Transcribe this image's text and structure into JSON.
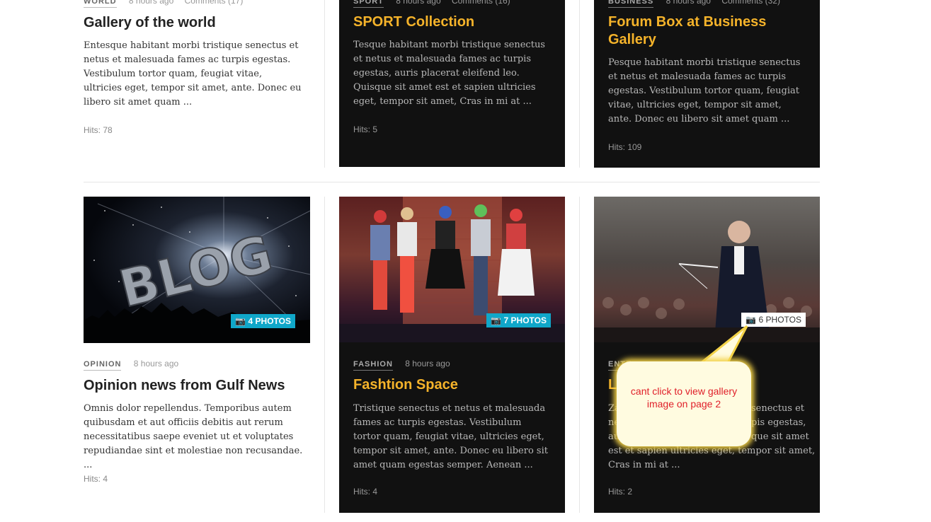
{
  "top_row": [
    {
      "category": "WORLD",
      "time": "8 hours ago",
      "comments": "Comments (17)",
      "title": "Gallery of the world",
      "excerpt": "Entesque habitant morbi tristique senectus et netus et malesuada fames ac turpis egestas. Vestibulum tortor quam, feugiat vitae, ultricies eget, tempor sit amet, ante. Donec eu libero sit amet quam ...",
      "hits": "Hits: 78"
    },
    {
      "category": "SPORT",
      "time": "8 hours ago",
      "comments": "Comments (16)",
      "title": "SPORT Collection",
      "excerpt": "Tesque habitant morbi tristique senectus et netus et malesuada fames ac turpis egestas, auris placerat eleifend leo. Quisque sit amet est et sapien ultricies eget, tempor sit amet, Cras in mi at ...",
      "hits": "Hits: 5"
    },
    {
      "category": "BUSINESS",
      "time": "8 hours ago",
      "comments": "Comments (32)",
      "title": "Forum Box at Business Gallery",
      "excerpt": "Pesque habitant morbi tristique senectus et netus et malesuada fames ac turpis egestas. Vestibulum tortor quam, feugiat vitae, ultricies eget, tempor sit amet, ante. Donec eu libero sit amet quam ...",
      "hits": "Hits: 109"
    }
  ],
  "bottom_row": [
    {
      "photos": "4 PHOTOS",
      "image_text": "BLOG",
      "category": "OPINION",
      "time": "8 hours ago",
      "title": "Opinion news from Gulf News",
      "excerpt": "Omnis dolor repellendus. Temporibus autem quibusdam et aut officiis debitis aut rerum necessitatibus saepe eveniet ut et voluptates repudiandae sint et molestiae non recusandae. ...",
      "hits": "Hits: 4"
    },
    {
      "photos": "7 PHOTOS",
      "category": "FASHION",
      "time": "8 hours ago",
      "title": "Fashtion Space",
      "excerpt": "Tristique senectus et netus et malesuada fames ac turpis egestas. Vestibulum tortor quam, feugiat vitae, ultricies eget, tempor sit amet, ante. Donec eu libero sit amet quam egestas semper. Aenean ...",
      "hits": "Hits: 4"
    },
    {
      "photos": "6 PHOTOS",
      "category": "ENTE",
      "title": "L",
      "excerpt_lines": [
        "Za",
        "ne",
        "au",
        "est et sapien ultricies eget, tempor sit amet,",
        "Cras in mi at ..."
      ],
      "excerpt_right": [
        "senectus et",
        "pis egestas,",
        "que sit amet"
      ],
      "hits": "Hits: 2"
    }
  ],
  "annotation": {
    "text": "cant click to view gallery image on page 2"
  },
  "icons": {
    "photo_badge": "camera-icon"
  },
  "colors": {
    "accent": "#f5b32a",
    "badge_blue": "#10a7c9",
    "dark_card": "#111111",
    "annotation_text": "#e0202a"
  }
}
